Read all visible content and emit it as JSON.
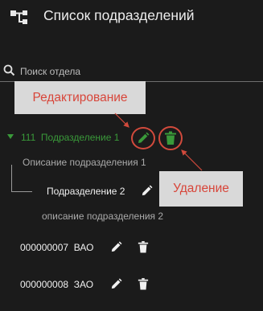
{
  "header": {
    "title": "Список подразделений",
    "icon": "hierarchy-icon"
  },
  "search": {
    "placeholder": "Поиск отдела",
    "value": "",
    "icon": "search-icon"
  },
  "callouts": {
    "edit": "Редактирование",
    "delete": "Удаление"
  },
  "tree": {
    "root": {
      "code": "111",
      "name": "Подразделение 1",
      "description": "Описание подразделения 1",
      "children": [
        {
          "name": "Подразделение 2",
          "description": "описание подразделения 2"
        }
      ]
    },
    "others": [
      {
        "code": "000000007",
        "name": "ВАО"
      },
      {
        "code": "000000008",
        "name": "ЗАО"
      }
    ]
  },
  "colors": {
    "background": "#1b1b1b",
    "active_green": "#3a9a3a",
    "callout_red": "#d24a3c",
    "callout_bg": "#d9d9d9"
  }
}
